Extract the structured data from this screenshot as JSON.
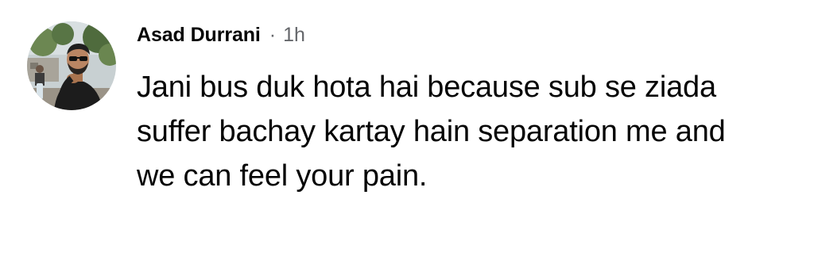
{
  "comment": {
    "author": "Asad Durrani",
    "separator": "·",
    "timestamp": "1h",
    "text": "Jani bus duk hota hai because sub se ziada suffer bachay kartay hain separation me and we can feel your pain."
  },
  "avatar": {
    "icon": "profile-photo",
    "colors": {
      "sky": "#c9d3d6",
      "foliage": "#5d7a46",
      "skin": "#b98563",
      "shirt": "#1b1b1b",
      "hair": "#202020"
    }
  }
}
